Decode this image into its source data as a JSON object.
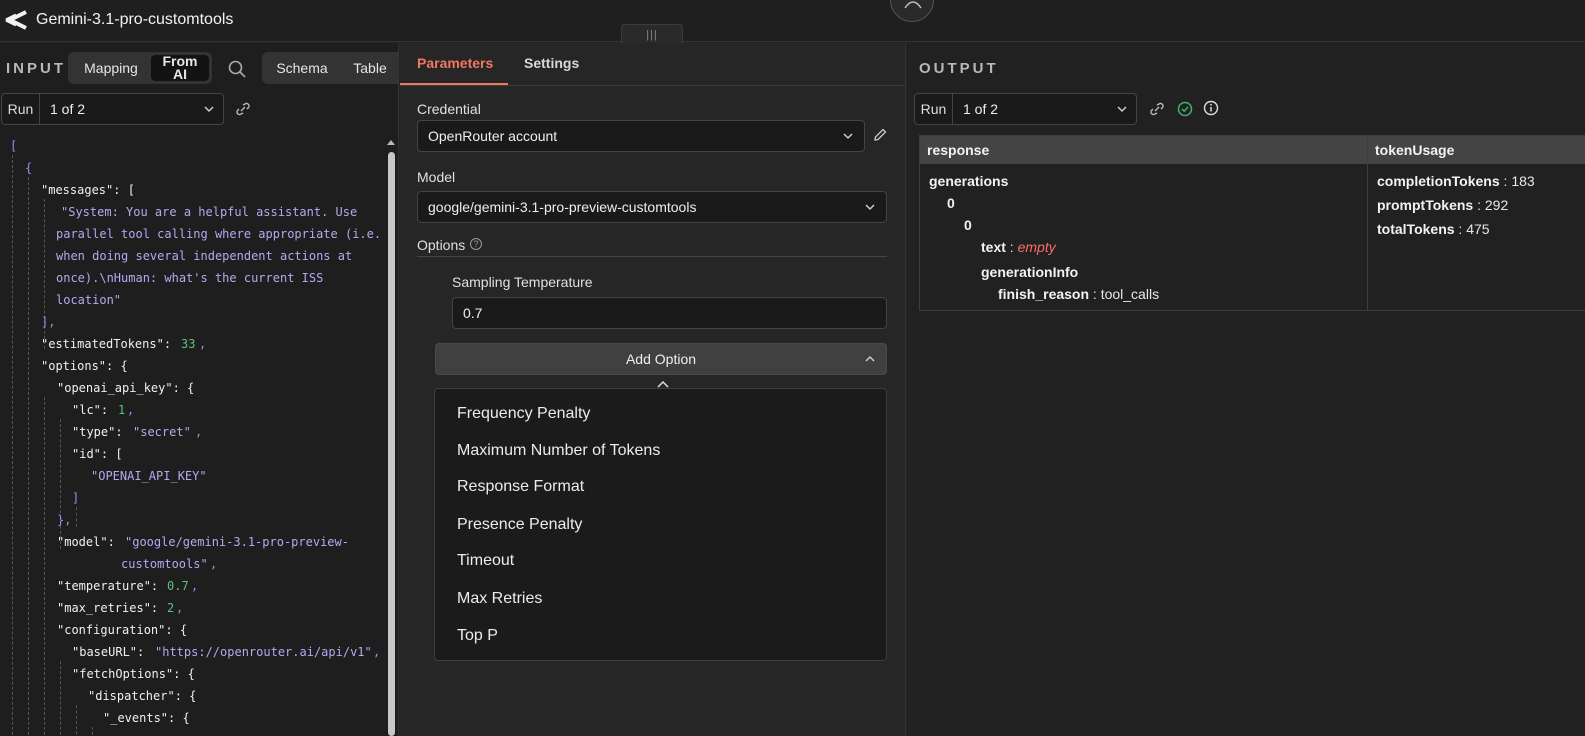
{
  "header": {
    "title": "Gemini-3.1-pro-customtools",
    "drag_handle": "|||"
  },
  "input": {
    "label": "INPUT",
    "mode_mapping": "Mapping",
    "mode_from_ai_line1": "From",
    "mode_from_ai_line2": "AI",
    "view_schema": "Schema",
    "view_table": "Table",
    "run_label": "Run",
    "run_value": "1 of 2"
  },
  "json_lines": [
    "[",
    "{",
    "\"messages\": [",
    "\"System: You are a helpful assistant. Use",
    "parallel tool calling where appropriate (i.e.",
    "when doing several independent actions at",
    "once).\\nHuman: what's the current ISS",
    "location\"",
    "],",
    "\"estimatedTokens\": ",
    "33",
    ",",
    "\"options\": {",
    "\"openai_api_key\": {",
    "\"lc\": ",
    "1",
    "\"type\": ",
    "\"secret\"",
    "\"id\": [",
    "\"OPENAI_API_KEY\"",
    "]",
    "},",
    "\"model\": ",
    "\"google/gemini-3.1-pro-preview-",
    "customtools\"",
    "\"temperature\": ",
    "0.7",
    "\"max_retries\": ",
    "2",
    "\"configuration\": {",
    "\"baseURL\": ",
    "\"https://openrouter.ai/api/v1\"",
    "\"fetchOptions\": {",
    "\"dispatcher\": {",
    "\"_events\": {"
  ],
  "params": {
    "tab_parameters": "Parameters",
    "tab_settings": "Settings",
    "credential_label": "Credential",
    "credential_value": "OpenRouter account",
    "model_label": "Model",
    "model_value": "google/gemini-3.1-pro-preview-customtools",
    "options_label": "Options",
    "help_glyph": "?",
    "temperature_label": "Sampling Temperature",
    "temperature_value": "0.7",
    "add_option_label": "Add Option",
    "option_items": [
      "Frequency Penalty",
      "Maximum Number of Tokens",
      "Response Format",
      "Presence Penalty",
      "Timeout",
      "Max Retries",
      "Top P"
    ]
  },
  "output": {
    "label": "OUTPUT",
    "run_label": "Run",
    "run_value": "1 of 2",
    "col_response": "response",
    "col_token_usage": "tokenUsage",
    "generations": "generations",
    "idx0": "0",
    "idx0b": "0",
    "text_key": "text",
    "text_value": "empty",
    "generation_info": "generationInfo",
    "finish_reason_key": "finish_reason",
    "finish_reason_value": "tool_calls",
    "completion_tokens_key": "completionTokens",
    "completion_tokens_value": "183",
    "prompt_tokens_key": "promptTokens",
    "prompt_tokens_value": "292",
    "total_tokens_key": "totalTokens",
    "total_tokens_value": "475",
    "sep": " : "
  },
  "colors": {
    "accent": "#f07860",
    "success": "#3fb36b",
    "empty": "#ff6b6b"
  }
}
